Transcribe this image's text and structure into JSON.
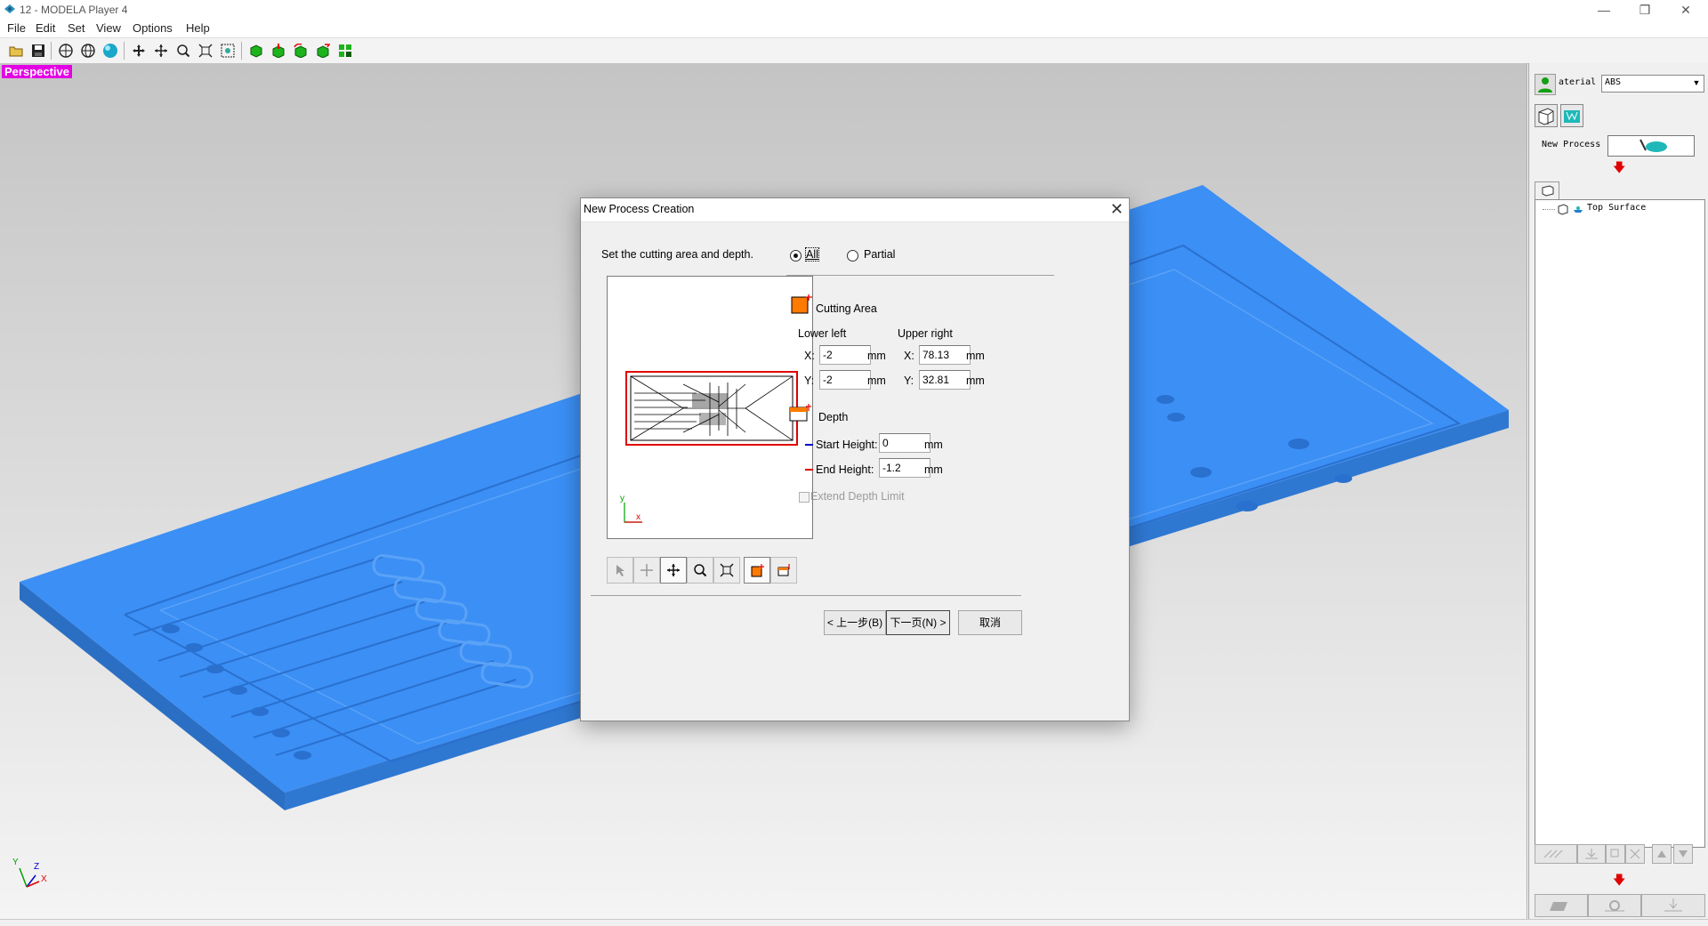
{
  "window": {
    "title": "12 - MODELA Player 4",
    "minimize_glyph": "—",
    "maximize_glyph": "❐",
    "close_glyph": "✕"
  },
  "menu": [
    "File",
    "Edit",
    "Set",
    "View",
    "Options",
    "Help"
  ],
  "toolbar": {
    "icons": [
      "open-file-icon",
      "save-icon",
      "view-top-icon",
      "view-front-icon",
      "render-sphere-icon",
      "move-icon",
      "pan-icon",
      "zoom-icon",
      "fit-icon",
      "zoom-window-icon",
      "model-green-icon",
      "model-down-icon",
      "model-rotate-icon",
      "model-arrow-icon",
      "model-layout-icon"
    ]
  },
  "viewport": {
    "view_label": "Perspective",
    "axis": {
      "x": "X",
      "y": "Y",
      "z": "Z"
    },
    "model_color": "#3b8ff5"
  },
  "right_panel": {
    "material_label": "aterial",
    "material_value": "ABS",
    "new_process_label": "New Process",
    "tree_item": "Top Surface"
  },
  "dialog": {
    "title": "New Process Creation",
    "close_glyph": "✕",
    "instruction": "Set the cutting area and depth.",
    "radio_all": "All",
    "radio_partial": "Partial",
    "cutting_area_title": "Cutting Area",
    "lower_left": "Lower left",
    "upper_right": "Upper right",
    "x_label": "X:",
    "y_label": "Y:",
    "unit": "mm",
    "lower_left_x": "-2",
    "lower_left_y": "-2",
    "upper_right_x": "78.13",
    "upper_right_y": "32.81",
    "depth_title": "Depth",
    "start_height_label": "Start Height:",
    "start_height_value": "0",
    "end_height_label": "End Height:",
    "end_height_value": "-1.2",
    "extend_depth_label": "Extend Depth Limit",
    "preview_axis_x": "x",
    "preview_axis_y": "y",
    "back_button": "< 上一步(B)",
    "next_button": "下一页(N) >",
    "cancel_button": "取消"
  }
}
